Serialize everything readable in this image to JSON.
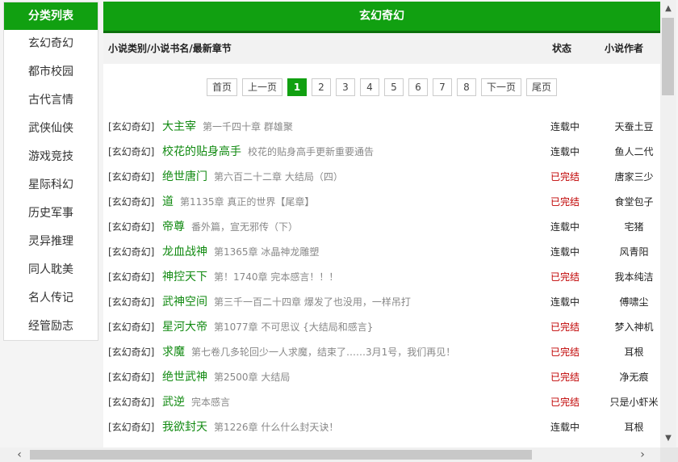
{
  "sidebar": {
    "title": "分类列表",
    "items": [
      "玄幻奇幻",
      "都市校园",
      "古代言情",
      "武侠仙侠",
      "游戏竞技",
      "星际科幻",
      "历史军事",
      "灵异推理",
      "同人耽美",
      "名人传记",
      "经管励志"
    ]
  },
  "main": {
    "title": "玄幻奇幻",
    "header": {
      "col1": "小说类别/小说书名/最新章节",
      "col2": "状态",
      "col3": "小说作者"
    }
  },
  "pagination": {
    "first": "首页",
    "prev": "上一页",
    "pages": [
      "1",
      "2",
      "3",
      "4",
      "5",
      "6",
      "7",
      "8"
    ],
    "current": "1",
    "next": "下一页",
    "last": "尾页"
  },
  "books": [
    {
      "category": "[玄幻奇幻]",
      "title": "大主宰",
      "chapter": "第一千四十章 群雄聚",
      "status": "连载中",
      "author": "天蚕土豆"
    },
    {
      "category": "[玄幻奇幻]",
      "title": "校花的贴身高手",
      "chapter": "校花的贴身高手更新重要通告",
      "status": "连载中",
      "author": "鱼人二代"
    },
    {
      "category": "[玄幻奇幻]",
      "title": "绝世唐门",
      "chapter": "第六百二十二章 大结局（四）",
      "status": "已完结",
      "author": "唐家三少"
    },
    {
      "category": "[玄幻奇幻]",
      "title": "道",
      "chapter": "第1135章 真正的世界【尾章】",
      "status": "已完结",
      "author": "食堂包子"
    },
    {
      "category": "[玄幻奇幻]",
      "title": "帝尊",
      "chapter": "番外篇，宣无邪传（下）",
      "status": "连载中",
      "author": "宅猪"
    },
    {
      "category": "[玄幻奇幻]",
      "title": "龙血战神",
      "chapter": "第1365章 冰晶神龙雕塑",
      "status": "连载中",
      "author": "风青阳"
    },
    {
      "category": "[玄幻奇幻]",
      "title": "神控天下",
      "chapter": "第！1740章 完本感言！！！",
      "status": "已完结",
      "author": "我本纯洁"
    },
    {
      "category": "[玄幻奇幻]",
      "title": "武神空间",
      "chapter": "第三千一百二十四章 爆发了也没用，一样吊打",
      "status": "连载中",
      "author": "傅啸尘"
    },
    {
      "category": "[玄幻奇幻]",
      "title": "星河大帝",
      "chapter": "第1077章 不可思议 {大结局和感言}",
      "status": "已完结",
      "author": "梦入神机"
    },
    {
      "category": "[玄幻奇幻]",
      "title": "求魔",
      "chapter": "第七卷几多轮回少一人求魔，结束了……3月1号，我们再见！",
      "status": "已完结",
      "author": "耳根"
    },
    {
      "category": "[玄幻奇幻]",
      "title": "绝世武神",
      "chapter": "第2500章 大结局",
      "status": "已完结",
      "author": "净无痕"
    },
    {
      "category": "[玄幻奇幻]",
      "title": "武逆",
      "chapter": "完本感言",
      "status": "已完结",
      "author": "只是小虾米"
    },
    {
      "category": "[玄幻奇幻]",
      "title": "我欲封天",
      "chapter": "第1226章 什么什么封天诀！",
      "status": "连载中",
      "author": "耳根"
    }
  ],
  "colors": {
    "brand_green": "#11a011",
    "title_green": "#118a11",
    "done_red": "#c00000"
  }
}
